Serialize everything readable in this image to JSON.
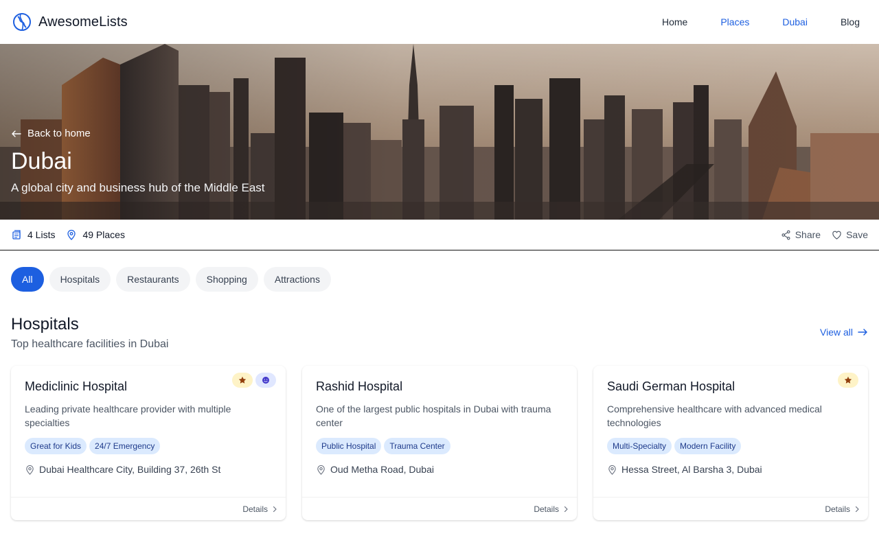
{
  "brand": {
    "name": "AwesomeLists",
    "icon": "globe-logo-icon"
  },
  "nav": [
    {
      "label": "Home",
      "active": false
    },
    {
      "label": "Places",
      "active": true
    },
    {
      "label": "Dubai",
      "active": true
    },
    {
      "label": "Blog",
      "active": false
    }
  ],
  "hero": {
    "back_label": "Back to home",
    "title": "Dubai",
    "subtitle": "A global city and business hub of the Middle East"
  },
  "stats": {
    "lists": "4 Lists",
    "places": "49 Places",
    "share": "Share",
    "save": "Save"
  },
  "filters": [
    "All",
    "Hospitals",
    "Restaurants",
    "Shopping",
    "Attractions"
  ],
  "section": {
    "title": "Hospitals",
    "subtitle": "Top healthcare facilities in Dubai",
    "view_all": "View all"
  },
  "cards": [
    {
      "title": "Mediclinic Hospital",
      "description": "Leading private healthcare provider with multiple specialties",
      "tags": [
        "Great for Kids",
        "24/7 Emergency"
      ],
      "address": "Dubai Healthcare City, Building 37, 26th St",
      "badges": [
        "star-icon",
        "smile-icon"
      ],
      "details": "Details"
    },
    {
      "title": "Rashid Hospital",
      "description": "One of the largest public hospitals in Dubai with trauma center",
      "tags": [
        "Public Hospital",
        "Trauma Center"
      ],
      "address": "Oud Metha Road, Dubai",
      "badges": [],
      "details": "Details"
    },
    {
      "title": "Saudi German Hospital",
      "description": "Comprehensive healthcare with advanced medical technologies",
      "tags": [
        "Multi-Specialty",
        "Modern Facility"
      ],
      "address": "Hessa Street, Al Barsha 3, Dubai",
      "badges": [
        "star-icon"
      ],
      "details": "Details"
    }
  ],
  "colors": {
    "accent": "#1d5fe0",
    "tag_bg": "#dbeafe",
    "tag_text": "#1e3a8a",
    "star_bg": "#fef3c7",
    "star": "#92400e",
    "smile_bg": "#e0e7ff",
    "smile": "#4338ca"
  }
}
